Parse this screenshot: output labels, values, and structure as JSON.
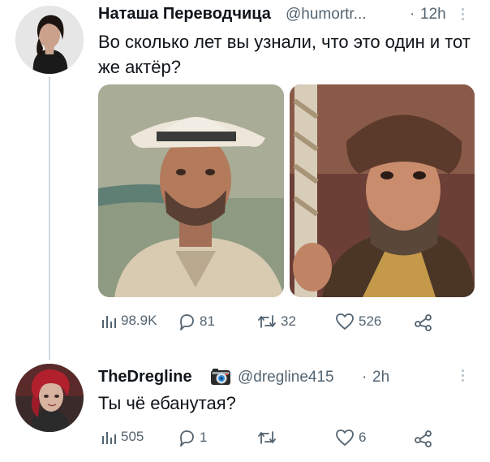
{
  "tweet1": {
    "author_name": "Наташа Переводчица",
    "handle": "@humortr...",
    "separator": "·",
    "time": "12h",
    "text": "Во сколько лет вы узнали, что это один и тот же актёр?",
    "stats": {
      "views": "98.9K",
      "replies": "81",
      "retweets": "32",
      "likes": "526"
    }
  },
  "tweet2": {
    "author_name": "TheDregline",
    "handle": "@dregline415",
    "separator": "·",
    "time": "2h",
    "text": "Ты чё ебанутая?",
    "stats": {
      "views": "505",
      "replies": "1",
      "retweets": "",
      "likes": "6"
    }
  },
  "colors": {
    "text": "#0f1419",
    "muted": "#536471",
    "thread": "#cfd9de"
  }
}
